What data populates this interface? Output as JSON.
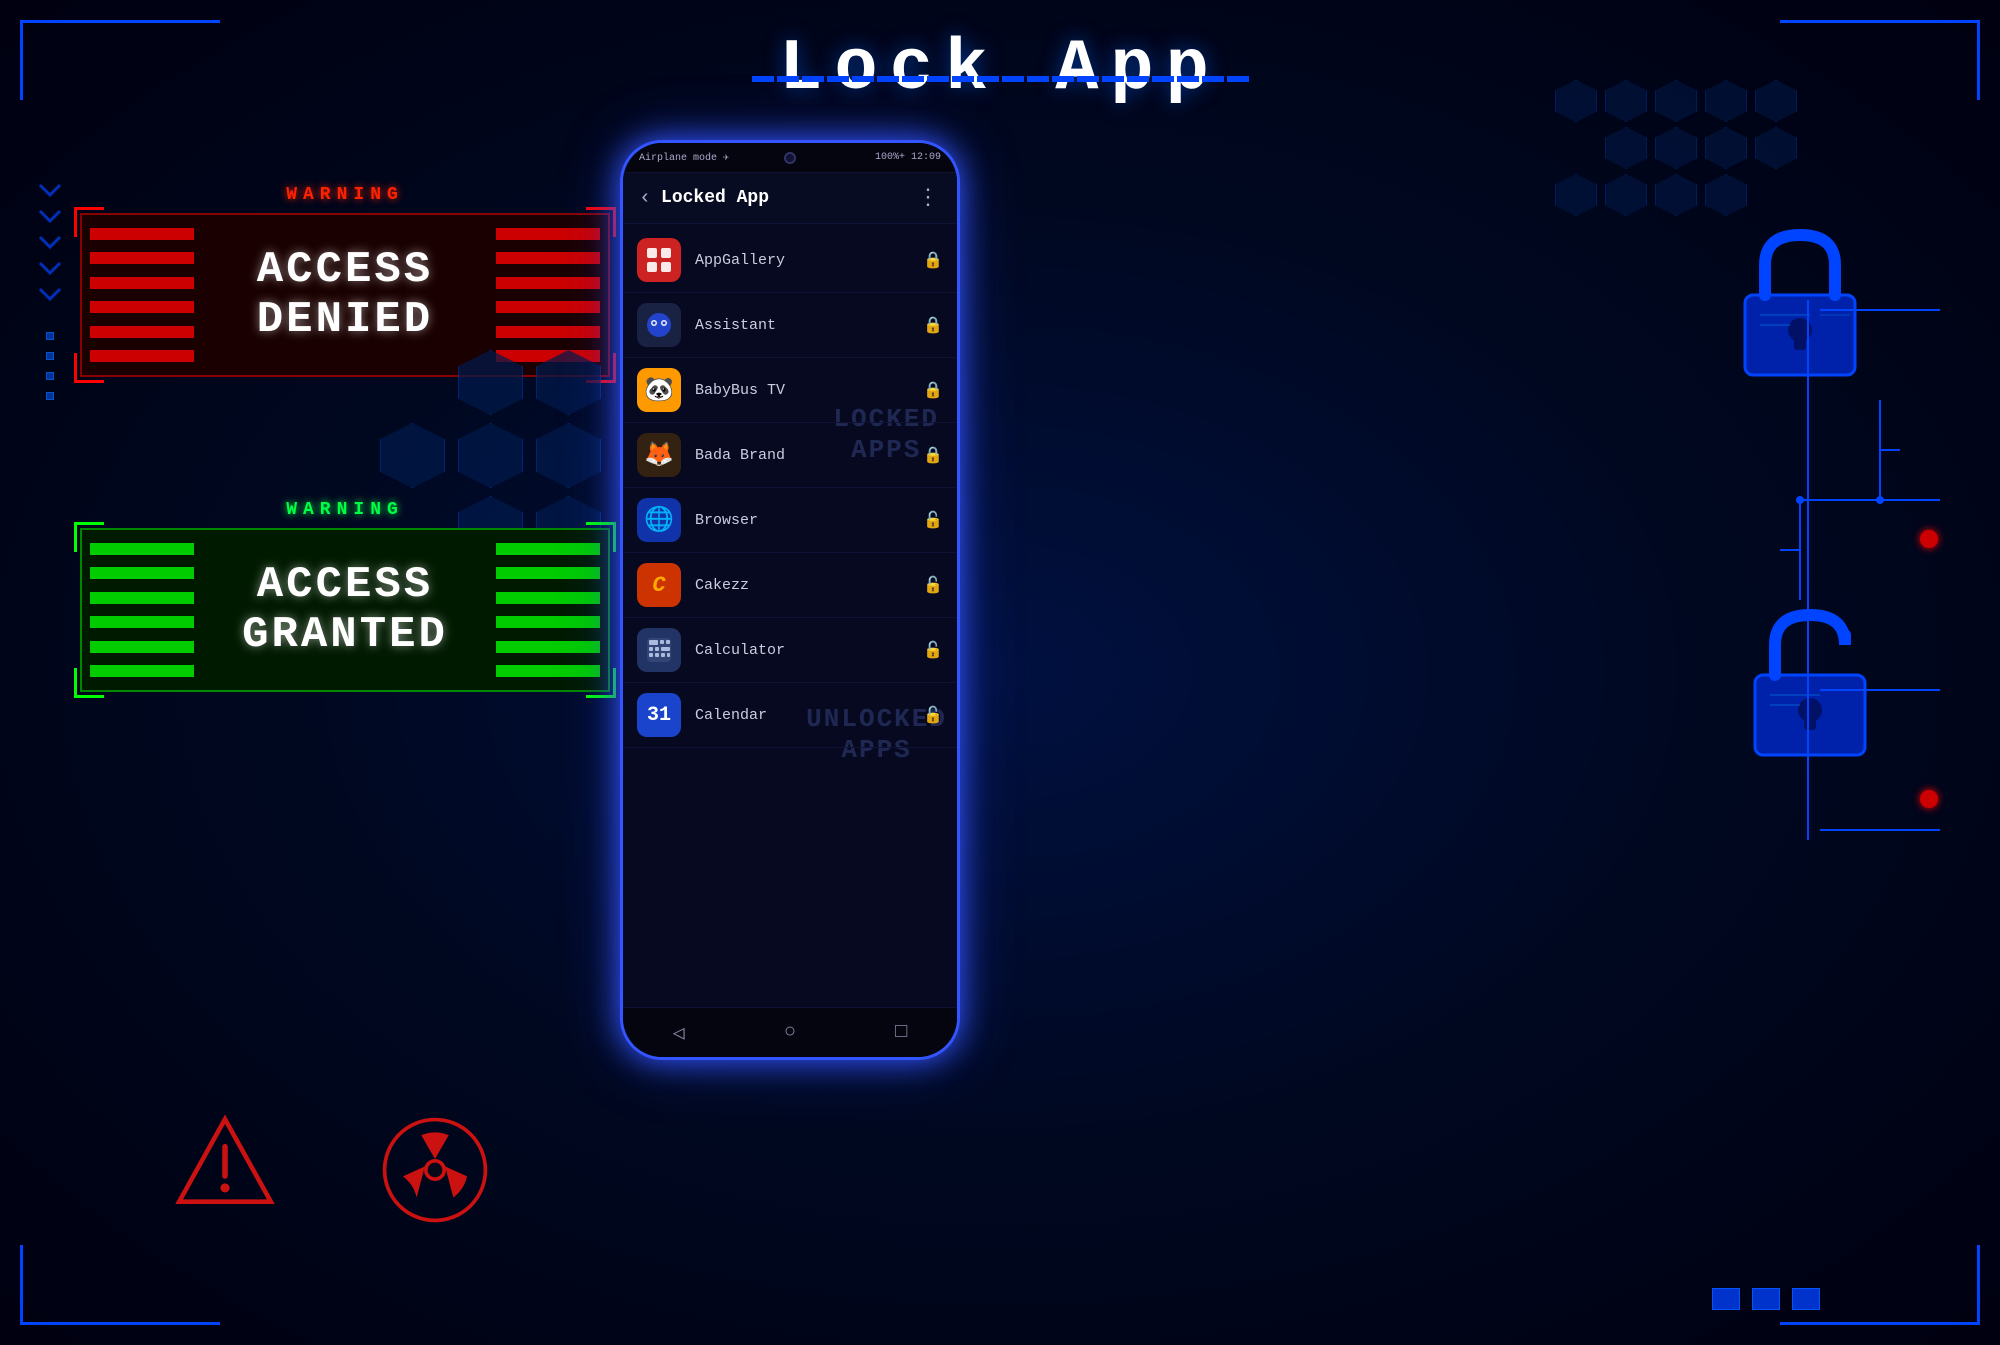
{
  "page": {
    "title": "Lock App",
    "background_color": "#000010"
  },
  "header": {
    "title": "Lock App"
  },
  "access_denied": {
    "warning_label": "WARNING",
    "title_line1": "ACCESS",
    "title_line2": "DENIED"
  },
  "access_granted": {
    "warning_label": "WARNING",
    "title_line1": "ACCESS",
    "title_line2": "GRANTED"
  },
  "phone": {
    "status_left": "Airplane mode ✈",
    "status_right": "100%+ 12:09",
    "app_title": "Locked App",
    "locked_watermark_line1": "LOCKED",
    "locked_watermark_line2": "APPS",
    "unlocked_watermark_line1": "UNLOCKED",
    "unlocked_watermark_line2": "APPS",
    "apps": [
      {
        "name": "AppGallery",
        "icon_color": "#cc2222",
        "icon_char": "🏪",
        "locked": true
      },
      {
        "name": "Assistant",
        "icon_color": "#2244cc",
        "icon_char": "🔵",
        "locked": true
      },
      {
        "name": "BabyBus TV",
        "icon_color": "#cc8800",
        "icon_char": "🐼",
        "locked": true
      },
      {
        "name": "Bada Brand",
        "icon_color": "#884400",
        "icon_char": "🦊",
        "locked": true
      },
      {
        "name": "Browser",
        "icon_color": "#2266cc",
        "icon_char": "🌐",
        "locked": false
      },
      {
        "name": "Cakezz",
        "icon_color": "#cc4400",
        "icon_char": "🎂",
        "locked": false
      },
      {
        "name": "Calculator",
        "icon_color": "#334477",
        "icon_char": "🧮",
        "locked": false
      },
      {
        "name": "Calendar",
        "icon_color": "#1155cc",
        "icon_char": "📅",
        "locked": false
      }
    ],
    "navbar": {
      "back": "◁",
      "home": "○",
      "recent": "□"
    }
  },
  "icons": {
    "warning_triangle": "⚠",
    "radiation": "☢",
    "lock_closed": "🔒",
    "lock_open": "🔓",
    "back_arrow": "‹",
    "more_menu": "⋮"
  },
  "colors": {
    "blue_accent": "#0044ff",
    "red_accent": "#cc0000",
    "green_accent": "#00cc00",
    "blue_glow": "#3355ff"
  }
}
